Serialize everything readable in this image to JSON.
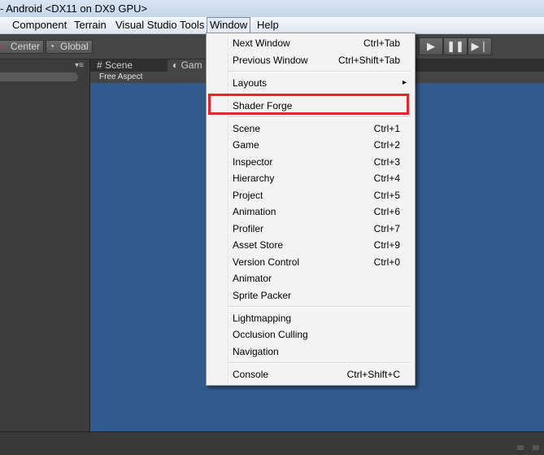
{
  "window": {
    "title": "- Android <DX11 on DX9 GPU>"
  },
  "menubar": {
    "items": [
      {
        "label": "Component"
      },
      {
        "label": "Terrain"
      },
      {
        "label": "Visual Studio Tools"
      },
      {
        "label": "Window"
      },
      {
        "label": "Help"
      }
    ],
    "active": "Window"
  },
  "toolbar": {
    "pivot_label": "Center",
    "space_label": "Global",
    "play_icons": [
      "play-icon",
      "pause-icon",
      "step-icon"
    ]
  },
  "view": {
    "tabs": [
      {
        "label": "Scene"
      },
      {
        "label": "Gam"
      }
    ],
    "aspect": "Free Aspect",
    "background_color": "#315a8e"
  },
  "window_menu": {
    "items": [
      {
        "label": "Next Window",
        "shortcut": "Ctrl+Tab"
      },
      {
        "label": "Previous Window",
        "shortcut": "Ctrl+Shift+Tab"
      },
      {
        "label": "Layouts",
        "submenu_arrow": "▸"
      },
      {
        "label": "Shader Forge",
        "highlighted": true
      },
      {
        "label": "Scene",
        "shortcut": "Ctrl+1"
      },
      {
        "label": "Game",
        "shortcut": "Ctrl+2"
      },
      {
        "label": "Inspector",
        "shortcut": "Ctrl+3"
      },
      {
        "label": "Hierarchy",
        "shortcut": "Ctrl+4"
      },
      {
        "label": "Project",
        "shortcut": "Ctrl+5"
      },
      {
        "label": "Animation",
        "shortcut": "Ctrl+6"
      },
      {
        "label": "Profiler",
        "shortcut": "Ctrl+7"
      },
      {
        "label": "Asset Store",
        "shortcut": "Ctrl+9"
      },
      {
        "label": "Version Control",
        "shortcut": "Ctrl+0"
      },
      {
        "label": "Animator"
      },
      {
        "label": "Sprite Packer"
      },
      {
        "label": "Lightmapping"
      },
      {
        "label": "Occlusion Culling"
      },
      {
        "label": "Navigation"
      },
      {
        "label": "Console",
        "shortcut": "Ctrl+Shift+C"
      }
    ],
    "highlight_color": "#e8262a"
  }
}
